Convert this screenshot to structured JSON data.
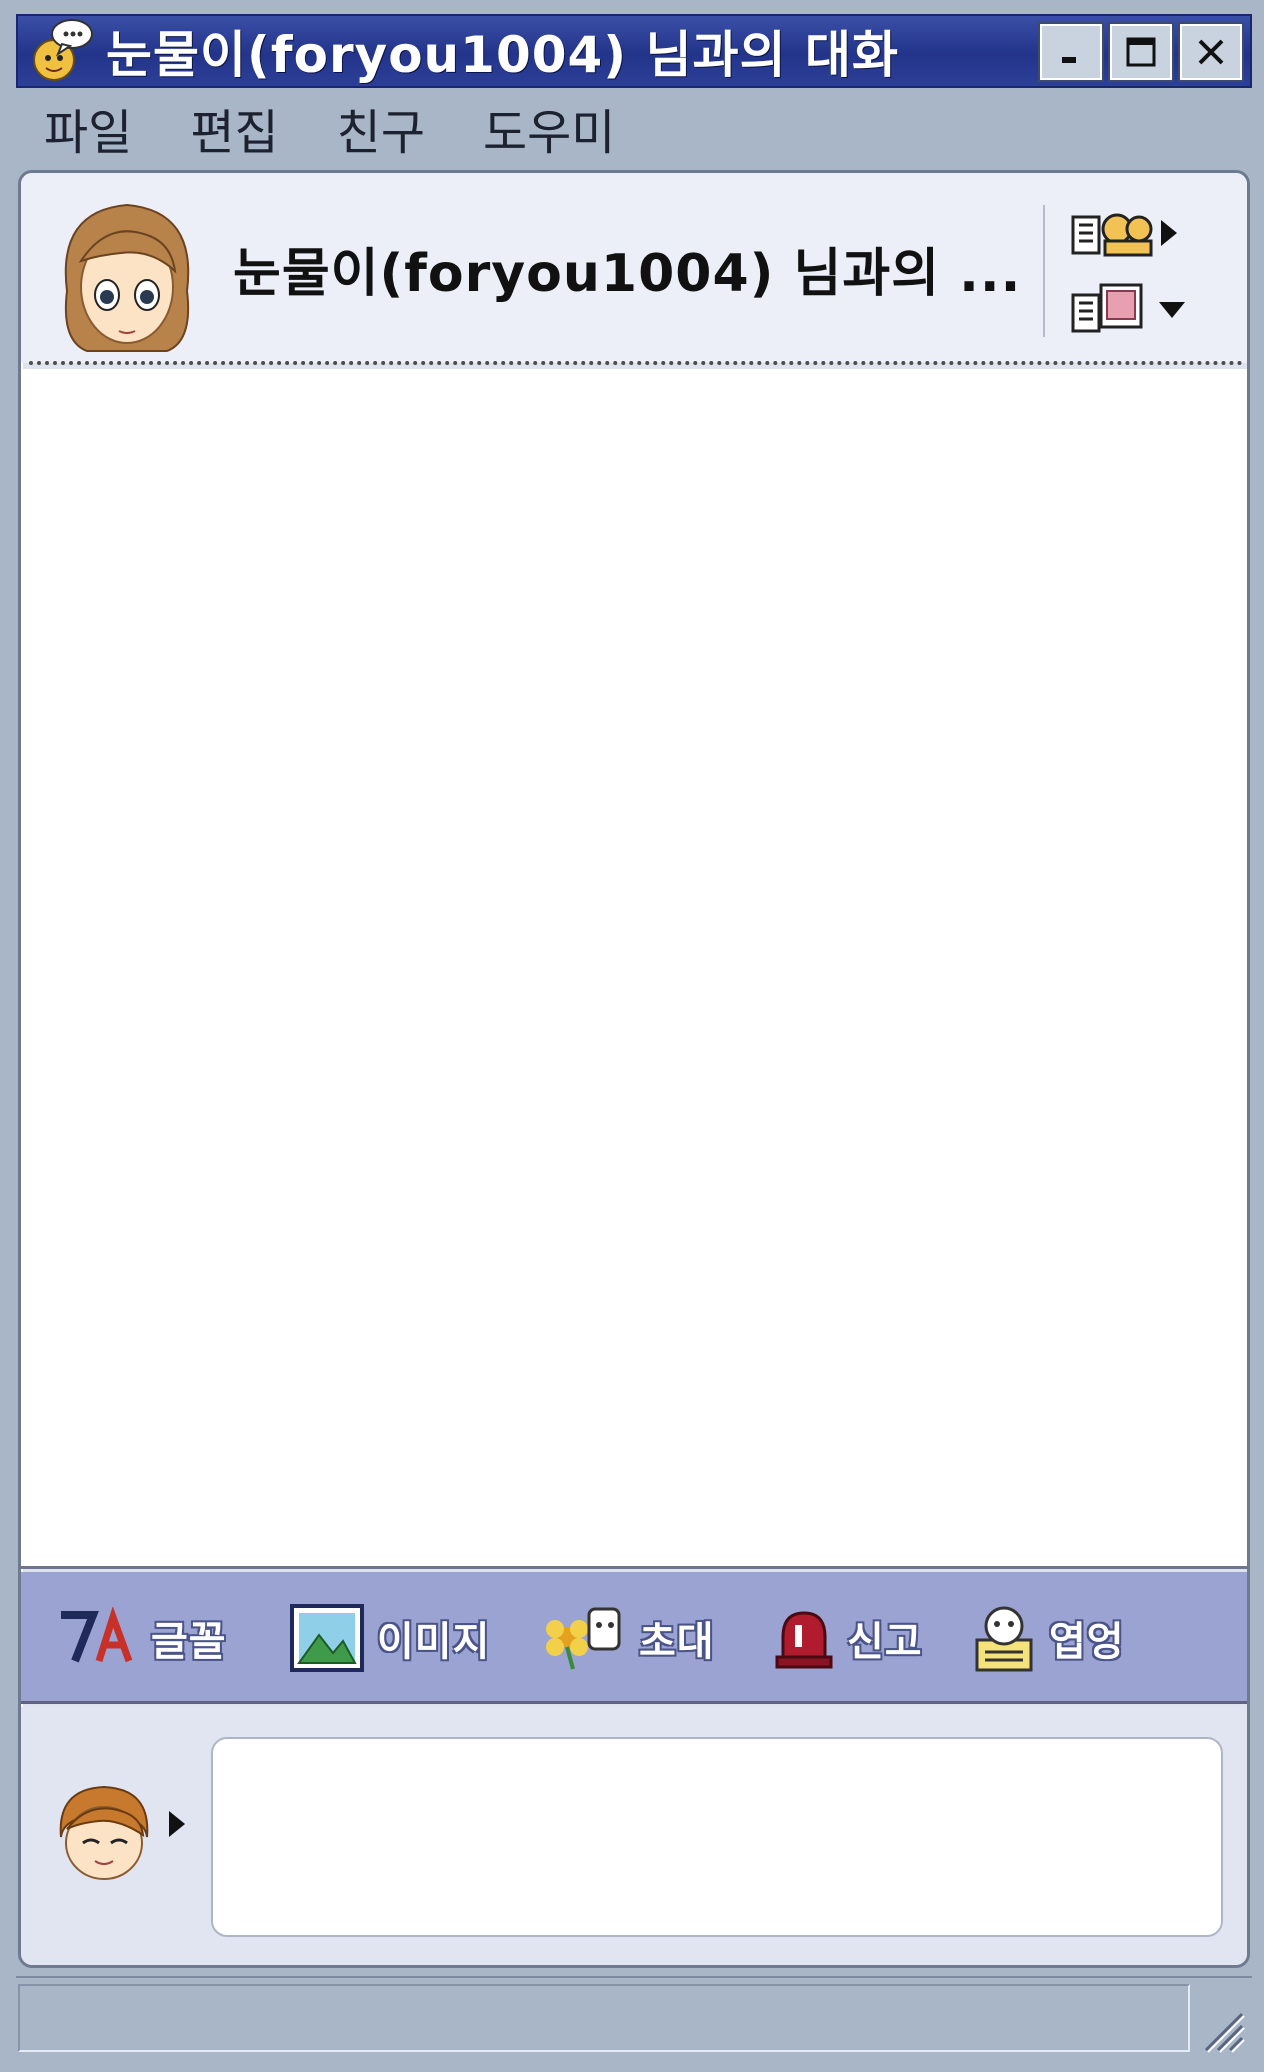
{
  "window": {
    "title": "눈물이(foryou1004) 님과의 대화",
    "controls": {
      "minimize": "minimize",
      "maximize": "maximize",
      "close": "close"
    }
  },
  "menu": [
    {
      "label": "파일"
    },
    {
      "label": "편집"
    },
    {
      "label": "친구"
    },
    {
      "label": "도우미"
    }
  ],
  "header": {
    "title": "눈물이(foryou1004) 님과의 ...",
    "avatar": "partner-avatar-girl",
    "buttons": [
      {
        "icon": "friend-list-icon",
        "arrow": "arrow-right-icon"
      },
      {
        "icon": "window-style-icon",
        "arrow": "arrow-down-icon"
      }
    ]
  },
  "toolbar": {
    "items": [
      {
        "label": "글꼴",
        "icon": "font-icon"
      },
      {
        "label": "이미지",
        "icon": "image-icon"
      },
      {
        "label": "초대",
        "icon": "invite-icon"
      },
      {
        "label": "신고",
        "icon": "report-icon"
      },
      {
        "label": "엽엉",
        "icon": "hide-icon"
      }
    ]
  },
  "input": {
    "value": "",
    "placeholder": ""
  },
  "colors": {
    "titlebar": "#23348a",
    "frame": "#a9b6c7",
    "toolbar": "#9aa3d2",
    "panel": "#dfe3f0"
  }
}
